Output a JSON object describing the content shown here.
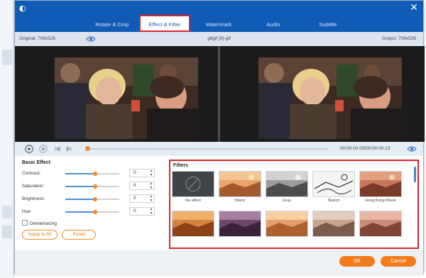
{
  "tabs": [
    {
      "label": "Rotate & Crop"
    },
    {
      "label": "Effect & Filter"
    },
    {
      "label": "Watermark"
    },
    {
      "label": "Audio"
    },
    {
      "label": "Subtitle"
    }
  ],
  "active_tab": "Effect & Filter",
  "info": {
    "original": "Original: 708x526",
    "filename": "gifgif (3)-gif",
    "output": "Output: 708x526"
  },
  "playback": {
    "timecode": "00:00:00.00/00:00:00.23",
    "progress_fraction": 0.0
  },
  "basic_effect": {
    "title": "Basic Effect",
    "rows": [
      {
        "label": "Contrast:",
        "value": "0",
        "level": 0.55
      },
      {
        "label": "Saturation:",
        "value": "0",
        "level": 0.55
      },
      {
        "label": "Brightness:",
        "value": "0",
        "level": 0.55
      },
      {
        "label": "Hue:",
        "value": "0",
        "level": 0.55
      }
    ],
    "deinterlacing": "Deinterlacing",
    "apply_all": "Apply to All",
    "reset": "Reset"
  },
  "filters": {
    "title": "Filters",
    "items": [
      {
        "label": "No effect"
      },
      {
        "label": "Warm"
      },
      {
        "label": "Gray"
      },
      {
        "label": "Sketch"
      },
      {
        "label": "Hong Kong Movie"
      },
      {
        "label": ""
      },
      {
        "label": ""
      },
      {
        "label": ""
      },
      {
        "label": ""
      },
      {
        "label": ""
      }
    ]
  },
  "footer": {
    "ok": "OK",
    "cancel": "Cancel"
  },
  "colors": {
    "titlebar": "#0f5bb5",
    "accent": "#f27c1c",
    "highlight": "#d9262b"
  },
  "icons": [
    "app-logo-icon",
    "close-icon",
    "eye-icon",
    "play-icon",
    "stop-icon",
    "prev-frame-icon",
    "next-frame-icon"
  ]
}
